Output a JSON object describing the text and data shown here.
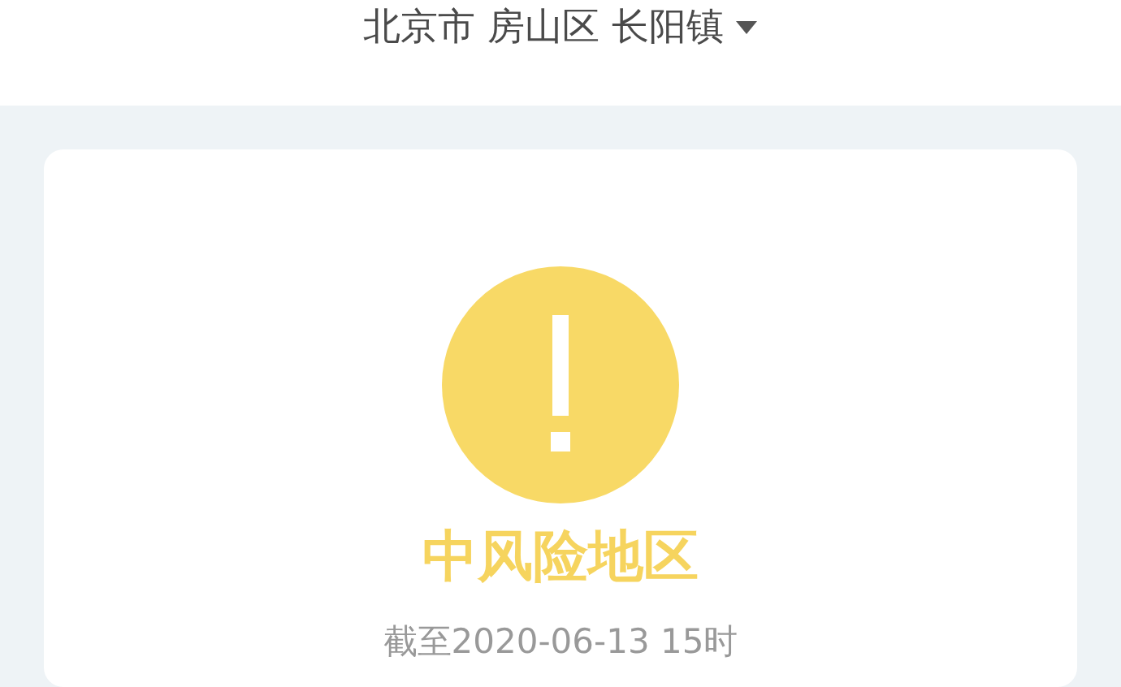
{
  "header": {
    "location": "北京市 房山区 长阳镇"
  },
  "risk": {
    "kind": "medium",
    "label": "中风险地区",
    "updated": "截至2020-06-13 15时"
  }
}
